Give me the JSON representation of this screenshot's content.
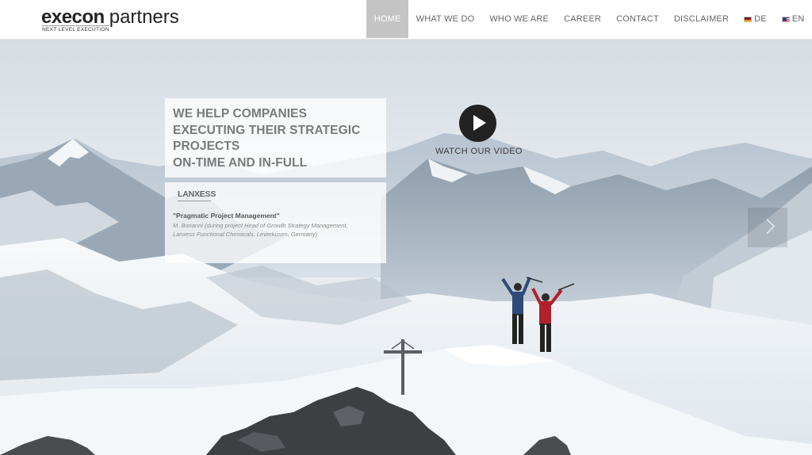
{
  "brand": {
    "name": "execon",
    "suffix": "partners",
    "tagline": "NEXT LEVEL EXECUTION"
  },
  "nav": {
    "items": [
      {
        "label": "HOME",
        "active": true
      },
      {
        "label": "WHAT WE DO"
      },
      {
        "label": "WHO WE ARE"
      },
      {
        "label": "CAREER"
      },
      {
        "label": "CONTACT"
      },
      {
        "label": "DISCLAIMER"
      }
    ],
    "languages": [
      {
        "label": "DE",
        "icon": "german-flag-icon"
      },
      {
        "label": "EN",
        "icon": "us-flag-icon"
      }
    ]
  },
  "hero": {
    "headline": [
      "WE HELP COMPANIES",
      "EXECUTING THEIR STRATEGIC",
      "PROJECTS",
      "ON-TIME AND IN-FULL"
    ],
    "video": {
      "label": "WATCH OUR VIDEO",
      "icon": "play-icon"
    },
    "testimonial": {
      "client_logo": "LANXESS",
      "title": "\"Pragmatic Project Management\"",
      "lines": [
        "M. Bonanni (during project Head of Growth Strategy Management,",
        "Lanxess Functional Chemicals, Leverkusen, Germany)"
      ]
    },
    "next_icon": "chevron-right-icon"
  },
  "colors": {
    "nav_active_bg": "#c4c4c4",
    "headline_text": "#7a7a7a",
    "play_button": "#222222"
  }
}
